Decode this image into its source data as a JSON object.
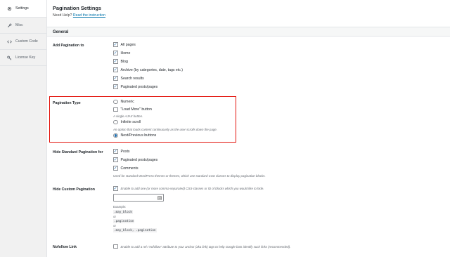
{
  "sidebar": {
    "items": [
      {
        "label": "Settings",
        "icon": "gear-icon"
      },
      {
        "label": "Misc",
        "icon": "wrench-icon"
      },
      {
        "label": "Custom Code",
        "icon": "code-icon"
      },
      {
        "label": "License Key",
        "icon": "key-icon"
      }
    ]
  },
  "header": {
    "title": "Pagination Settings",
    "help_prefix": "Need Help?",
    "help_link": "Read the instruction"
  },
  "section": {
    "title": "General"
  },
  "add_pagination": {
    "label": "Add Pagination to",
    "options": [
      {
        "label": "All pages",
        "checked": true
      },
      {
        "label": "Home",
        "checked": true
      },
      {
        "label": "Blog",
        "checked": true
      },
      {
        "label": "Archive (by categories, date, tags etc.)",
        "checked": true
      },
      {
        "label": "Search results",
        "checked": true
      },
      {
        "label": "Paginated posts/pages",
        "checked": true
      }
    ]
  },
  "pagination_type": {
    "label": "Pagination Type",
    "numeric": "Numeric",
    "load_more": "\"Load More\" button",
    "load_more_desc": "A single AJAX button.",
    "infinite": "Infinite scroll",
    "infinite_desc": "An option that loads content continuously as the user scrolls down the page.",
    "next_prev": "Next/Previous buttons"
  },
  "hide_standard": {
    "label": "Hide Standard Pagination for",
    "options": [
      {
        "label": "Posts",
        "checked": true
      },
      {
        "label": "Paginated posts/pages",
        "checked": true
      },
      {
        "label": "Comments",
        "checked": true
      }
    ],
    "desc": "Used for standard WordPress themes or themes, which use standard CSS classes to display pagination blocks."
  },
  "hide_custom": {
    "label": "Hide Custom Pagination",
    "checkbox_text": "Enable to add one (or more comma-separated) CSS-classes or ID of blocks which you would like to hide.",
    "example_label": "Example:",
    "example1": ".may_block",
    "or1": "or",
    "example2": ".pagination",
    "or2": "or",
    "example3": ".may_block, .pagination"
  },
  "nofollow": {
    "label": "Nofollow Link",
    "checkbox_text": "Enable to add a rel=\"nofollow\" attribute to your anchor (aka link) tags to help Google bots identify such links (recommended)."
  },
  "colors": {
    "accent": "#2271b1",
    "highlight": "#e3120b",
    "link": "#0073aa"
  }
}
